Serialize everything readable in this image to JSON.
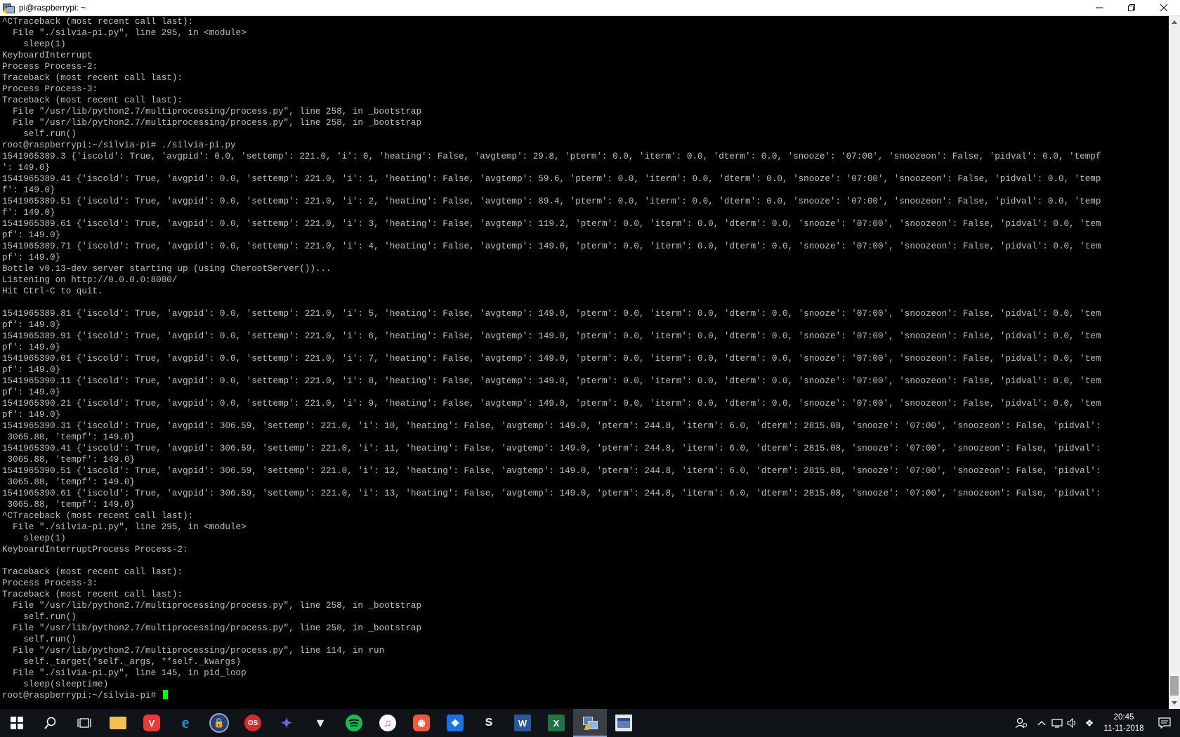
{
  "window": {
    "title": "pi@raspberrypi: ~",
    "minimize_label": "─",
    "maximize_label": "❐",
    "close_label": "✕"
  },
  "terminal": {
    "lines": [
      "^CTraceback (most recent call last):",
      "  File \"./silvia-pi.py\", line 295, in <module>",
      "    sleep(1)",
      "KeyboardInterrupt",
      "Process Process-2:",
      "Traceback (most recent call last):",
      "Process Process-3:",
      "Traceback (most recent call last):",
      "  File \"/usr/lib/python2.7/multiprocessing/process.py\", line 258, in _bootstrap",
      "  File \"/usr/lib/python2.7/multiprocessing/process.py\", line 258, in _bootstrap",
      "    self.run()",
      "root@raspberrypi:~/silvia-pi# ./silvia-pi.py",
      "1541965389.3 {'iscold': True, 'avgpid': 0.0, 'settemp': 221.0, 'i': 0, 'heating': False, 'avgtemp': 29.8, 'pterm': 0.0, 'iterm': 0.0, 'dterm': 0.0, 'snooze': '07:00', 'snoozeon': False, 'pidval': 0.0, 'tempf",
      "': 149.0}",
      "1541965389.41 {'iscold': True, 'avgpid': 0.0, 'settemp': 221.0, 'i': 1, 'heating': False, 'avgtemp': 59.6, 'pterm': 0.0, 'iterm': 0.0, 'dterm': 0.0, 'snooze': '07:00', 'snoozeon': False, 'pidval': 0.0, 'temp",
      "f': 149.0}",
      "1541965389.51 {'iscold': True, 'avgpid': 0.0, 'settemp': 221.0, 'i': 2, 'heating': False, 'avgtemp': 89.4, 'pterm': 0.0, 'iterm': 0.0, 'dterm': 0.0, 'snooze': '07:00', 'snoozeon': False, 'pidval': 0.0, 'temp",
      "f': 149.0}",
      "1541965389.61 {'iscold': True, 'avgpid': 0.0, 'settemp': 221.0, 'i': 3, 'heating': False, 'avgtemp': 119.2, 'pterm': 0.0, 'iterm': 0.0, 'dterm': 0.0, 'snooze': '07:00', 'snoozeon': False, 'pidval': 0.0, 'tem",
      "pf': 149.0}",
      "1541965389.71 {'iscold': True, 'avgpid': 0.0, 'settemp': 221.0, 'i': 4, 'heating': False, 'avgtemp': 149.0, 'pterm': 0.0, 'iterm': 0.0, 'dterm': 0.0, 'snooze': '07:00', 'snoozeon': False, 'pidval': 0.0, 'tem",
      "pf': 149.0}",
      "Bottle v0.13-dev server starting up (using CherootServer())...",
      "Listening on http://0.0.0.0:8080/",
      "Hit Ctrl-C to quit.",
      "",
      "1541965389.81 {'iscold': True, 'avgpid': 0.0, 'settemp': 221.0, 'i': 5, 'heating': False, 'avgtemp': 149.0, 'pterm': 0.0, 'iterm': 0.0, 'dterm': 0.0, 'snooze': '07:00', 'snoozeon': False, 'pidval': 0.0, 'tem",
      "pf': 149.0}",
      "1541965389.91 {'iscold': True, 'avgpid': 0.0, 'settemp': 221.0, 'i': 6, 'heating': False, 'avgtemp': 149.0, 'pterm': 0.0, 'iterm': 0.0, 'dterm': 0.0, 'snooze': '07:00', 'snoozeon': False, 'pidval': 0.0, 'tem",
      "pf': 149.0}",
      "1541965390.01 {'iscold': True, 'avgpid': 0.0, 'settemp': 221.0, 'i': 7, 'heating': False, 'avgtemp': 149.0, 'pterm': 0.0, 'iterm': 0.0, 'dterm': 0.0, 'snooze': '07:00', 'snoozeon': False, 'pidval': 0.0, 'tem",
      "pf': 149.0}",
      "1541965390.11 {'iscold': True, 'avgpid': 0.0, 'settemp': 221.0, 'i': 8, 'heating': False, 'avgtemp': 149.0, 'pterm': 0.0, 'iterm': 0.0, 'dterm': 0.0, 'snooze': '07:00', 'snoozeon': False, 'pidval': 0.0, 'tem",
      "pf': 149.0}",
      "1541965390.21 {'iscold': True, 'avgpid': 0.0, 'settemp': 221.0, 'i': 9, 'heating': False, 'avgtemp': 149.0, 'pterm': 0.0, 'iterm': 0.0, 'dterm': 0.0, 'snooze': '07:00', 'snoozeon': False, 'pidval': 0.0, 'tem",
      "pf': 149.0}",
      "1541965390.31 {'iscold': True, 'avgpid': 306.59, 'settemp': 221.0, 'i': 10, 'heating': False, 'avgtemp': 149.0, 'pterm': 244.8, 'iterm': 6.0, 'dterm': 2815.08, 'snooze': '07:00', 'snoozeon': False, 'pidval':",
      " 3065.88, 'tempf': 149.0}",
      "1541965390.41 {'iscold': True, 'avgpid': 306.59, 'settemp': 221.0, 'i': 11, 'heating': False, 'avgtemp': 149.0, 'pterm': 244.8, 'iterm': 6.0, 'dterm': 2815.08, 'snooze': '07:00', 'snoozeon': False, 'pidval':",
      " 3065.88, 'tempf': 149.0}",
      "1541965390.51 {'iscold': True, 'avgpid': 306.59, 'settemp': 221.0, 'i': 12, 'heating': False, 'avgtemp': 149.0, 'pterm': 244.8, 'iterm': 6.0, 'dterm': 2815.08, 'snooze': '07:00', 'snoozeon': False, 'pidval':",
      " 3065.88, 'tempf': 149.0}",
      "1541965390.61 {'iscold': True, 'avgpid': 306.59, 'settemp': 221.0, 'i': 13, 'heating': False, 'avgtemp': 149.0, 'pterm': 244.8, 'iterm': 6.0, 'dterm': 2815.08, 'snooze': '07:00', 'snoozeon': False, 'pidval':",
      " 3065.88, 'tempf': 149.0}",
      "^CTraceback (most recent call last):",
      "  File \"./silvia-pi.py\", line 295, in <module>",
      "    sleep(1)",
      "KeyboardInterruptProcess Process-2:",
      "",
      "Traceback (most recent call last):",
      "Process Process-3:",
      "Traceback (most recent call last):",
      "  File \"/usr/lib/python2.7/multiprocessing/process.py\", line 258, in _bootstrap",
      "    self.run()",
      "  File \"/usr/lib/python2.7/multiprocessing/process.py\", line 258, in _bootstrap",
      "    self.run()",
      "  File \"/usr/lib/python2.7/multiprocessing/process.py\", line 114, in run",
      "    self._target(*self._args, **self._kwargs)",
      "  File \"./silvia-pi.py\", line 145, in pid_loop",
      "    sleep(sleeptime)"
    ],
    "prompt": "root@raspberrypi:~/silvia-pi# ",
    "cursor_color": "#00ff00",
    "text_color": "#bfbfbf",
    "background": "#000000"
  },
  "taskbar": {
    "apps": [
      {
        "name": "start-button",
        "icon": "windows-logo-icon",
        "active": false
      },
      {
        "name": "search-button",
        "icon": "search-icon",
        "active": false
      },
      {
        "name": "task-view-button",
        "icon": "task-view-icon",
        "active": false
      },
      {
        "name": "file-explorer",
        "icon": "folder-icon",
        "active": false
      },
      {
        "name": "vivaldi",
        "icon": "vivaldi-icon",
        "active": false
      },
      {
        "name": "edge",
        "icon": "edge-icon",
        "active": false
      },
      {
        "name": "vpn",
        "icon": "lock-icon",
        "active": false
      },
      {
        "name": "app-os",
        "icon": "os-icon",
        "active": false
      },
      {
        "name": "app-bird",
        "icon": "bird-icon",
        "active": false
      },
      {
        "name": "app-fox",
        "icon": "fox-icon",
        "active": false
      },
      {
        "name": "spotify",
        "icon": "spotify-icon",
        "active": false
      },
      {
        "name": "itunes",
        "icon": "music-note-icon",
        "active": false
      },
      {
        "name": "app-camera",
        "icon": "camera-icon",
        "active": false
      },
      {
        "name": "dropbox",
        "icon": "dropbox-icon",
        "active": false
      },
      {
        "name": "app-s",
        "icon": "s-icon",
        "active": false
      },
      {
        "name": "word",
        "icon": "word-icon",
        "active": false
      },
      {
        "name": "excel",
        "icon": "excel-icon",
        "active": false
      },
      {
        "name": "putty",
        "icon": "putty-icon",
        "active": true
      },
      {
        "name": "app-window",
        "icon": "window-icon",
        "active": false
      }
    ],
    "tray": {
      "time": "20:45",
      "date": "11-11-2018"
    }
  }
}
